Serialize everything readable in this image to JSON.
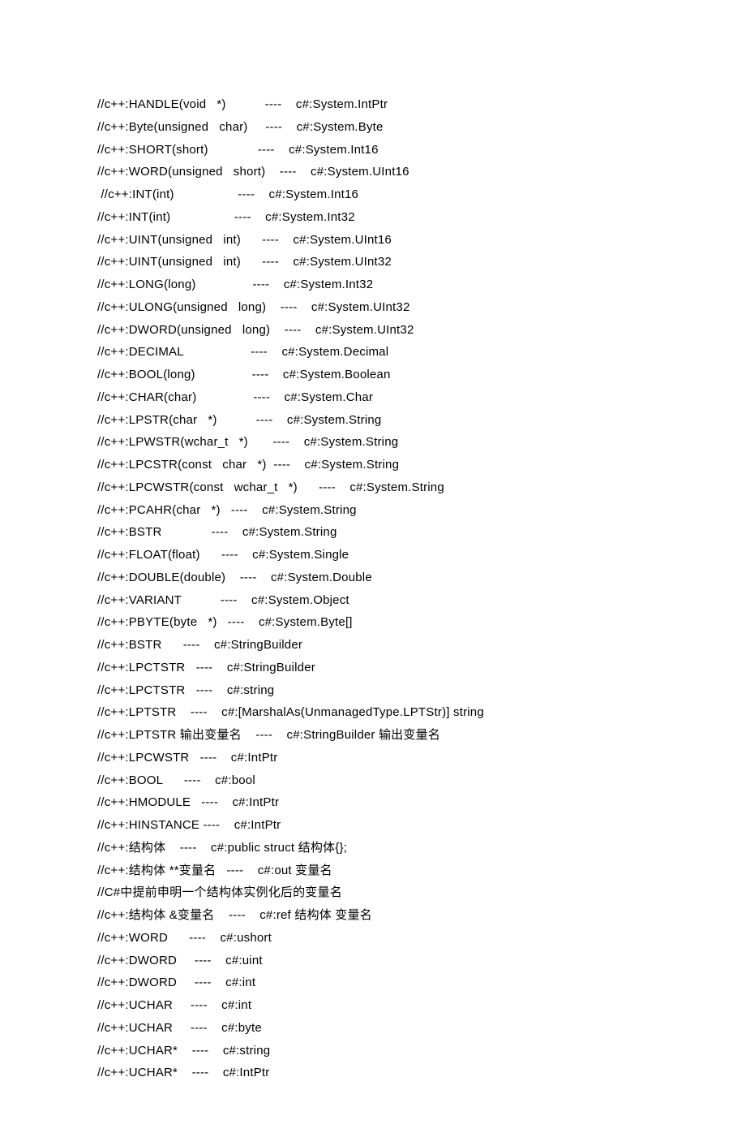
{
  "lines": [
    "//c++:HANDLE(void   *)           ----    c#:System.IntPtr",
    "//c++:Byte(unsigned   char)     ----    c#:System.Byte",
    "//c++:SHORT(short)              ----    c#:System.Int16",
    "//c++:WORD(unsigned   short)    ----    c#:System.UInt16",
    " //c++:INT(int)                  ----    c#:System.Int16",
    "//c++:INT(int)                  ----    c#:System.Int32",
    "//c++:UINT(unsigned   int)      ----    c#:System.UInt16",
    "//c++:UINT(unsigned   int)      ----    c#:System.UInt32",
    "//c++:LONG(long)                ----    c#:System.Int32",
    "//c++:ULONG(unsigned   long)    ----    c#:System.UInt32",
    "//c++:DWORD(unsigned   long)    ----    c#:System.UInt32",
    "//c++:DECIMAL                   ----    c#:System.Decimal",
    "//c++:BOOL(long)                ----    c#:System.Boolean",
    "//c++:CHAR(char)                ----    c#:System.Char",
    "//c++:LPSTR(char   *)           ----    c#:System.String",
    "//c++:LPWSTR(wchar_t   *)       ----    c#:System.String",
    "//c++:LPCSTR(const   char   *)  ----    c#:System.String",
    "//c++:LPCWSTR(const   wchar_t   *)      ----    c#:System.String",
    "//c++:PCAHR(char   *)   ----    c#:System.String",
    "//c++:BSTR              ----    c#:System.String",
    "//c++:FLOAT(float)      ----    c#:System.Single",
    "//c++:DOUBLE(double)    ----    c#:System.Double",
    "//c++:VARIANT           ----    c#:System.Object",
    "//c++:PBYTE(byte   *)   ----    c#:System.Byte[]",
    "//c++:BSTR      ----    c#:StringBuilder",
    "//c++:LPCTSTR   ----    c#:StringBuilder",
    "//c++:LPCTSTR   ----    c#:string",
    "//c++:LPTSTR    ----    c#:[MarshalAs(UnmanagedType.LPTStr)] string",
    "//c++:LPTSTR 输出变量名    ----    c#:StringBuilder 输出变量名",
    "//c++:LPCWSTR   ----    c#:IntPtr",
    "//c++:BOOL      ----    c#:bool",
    "//c++:HMODULE   ----    c#:IntPtr",
    "//c++:HINSTANCE ----    c#:IntPtr",
    "//c++:结构体    ----    c#:public struct 结构体{};",
    "//c++:结构体 **变量名   ----    c#:out 变量名",
    "//C#中提前申明一个结构体实例化后的变量名",
    "//c++:结构体 &变量名    ----    c#:ref 结构体 变量名",
    "//c++:WORD      ----    c#:ushort",
    "//c++:DWORD     ----    c#:uint",
    "//c++:DWORD     ----    c#:int",
    "//c++:UCHAR     ----    c#:int",
    "//c++:UCHAR     ----    c#:byte",
    "//c++:UCHAR*    ----    c#:string",
    "//c++:UCHAR*    ----    c#:IntPtr"
  ]
}
